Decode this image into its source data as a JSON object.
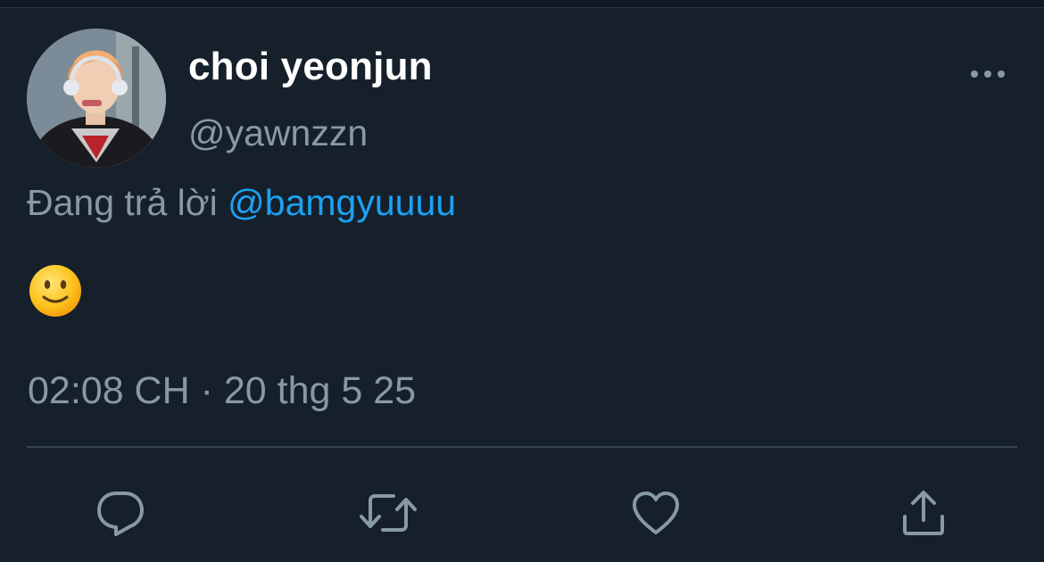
{
  "tweet": {
    "display_name": "choi yeonjun",
    "handle": "@yawnzzn",
    "replying_prefix": "Đang trả lời",
    "replying_to": "@bamgyuuuu",
    "body_emoji": "🙂",
    "timestamp": "02:08 CH · 20 thg 5 25"
  },
  "icons": {
    "more": "more-horizontal-icon",
    "reply": "reply-icon",
    "retweet": "retweet-icon",
    "like": "heart-icon",
    "share": "share-icon"
  },
  "colors": {
    "background": "#15202b",
    "text_primary": "#ffffff",
    "text_secondary": "#8899a6",
    "accent": "#1da1f2",
    "divider": "#38444d"
  }
}
